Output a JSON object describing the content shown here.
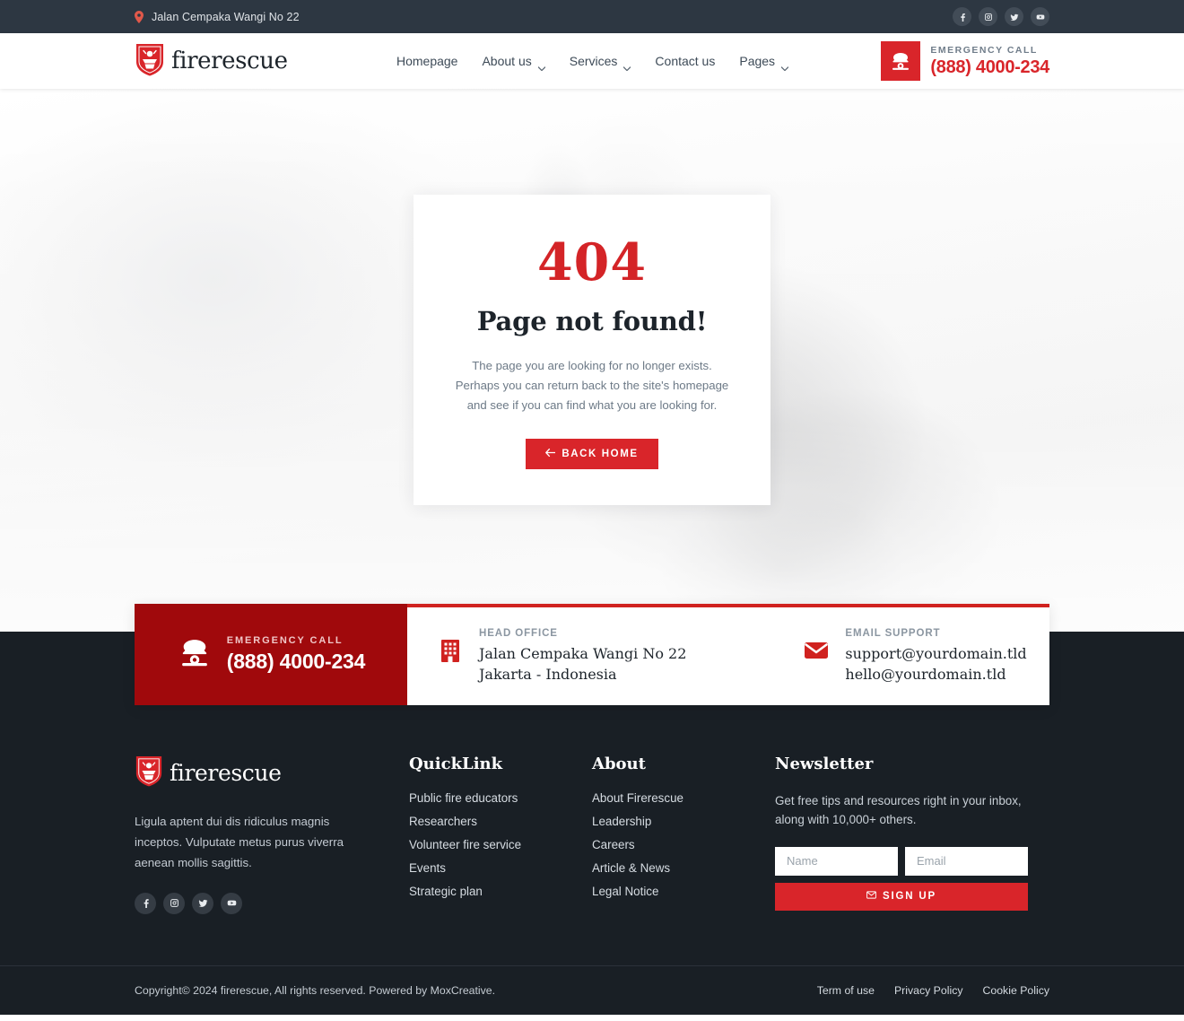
{
  "topbar": {
    "address": "Jalan Cempaka Wangi No 22",
    "pin_icon": "location-pin-icon",
    "social": [
      {
        "name": "facebook",
        "icon": "facebook-icon"
      },
      {
        "name": "instagram",
        "icon": "instagram-icon"
      },
      {
        "name": "twitter",
        "icon": "twitter-icon"
      },
      {
        "name": "youtube",
        "icon": "youtube-icon"
      }
    ]
  },
  "header": {
    "brand": "firerescue",
    "nav": [
      {
        "label": "Homepage",
        "dropdown": false
      },
      {
        "label": "About us",
        "dropdown": true
      },
      {
        "label": "Services",
        "dropdown": true
      },
      {
        "label": "Contact us",
        "dropdown": false
      },
      {
        "label": "Pages",
        "dropdown": true
      }
    ],
    "emergency_label": "EMERGENCY CALL",
    "emergency_number": "(888) 4000-234",
    "phone_icon": "telephone-icon"
  },
  "hero": {
    "code": "404",
    "title": "Page not found!",
    "description": "The page you are looking for no longer exists. Perhaps you can return back to the site's homepage and see if you can find what you are looking for.",
    "button_label": "BACK HOME",
    "button_icon": "arrow-left-icon"
  },
  "contact_bar": {
    "emergency": {
      "label": "EMERGENCY CALL",
      "number": "(888) 4000-234",
      "icon": "telephone-icon"
    },
    "head_office": {
      "label": "HEAD OFFICE",
      "line1": "Jalan Cempaka Wangi No 22",
      "line2": "Jakarta - Indonesia",
      "icon": "building-icon"
    },
    "email_support": {
      "label": "EMAIL SUPPORT",
      "line1": "support@yourdomain.tld",
      "line2": "hello@yourdomain.tld",
      "icon": "envelope-icon"
    }
  },
  "footer": {
    "brand": "firerescue",
    "description": "Ligula aptent dui dis ridiculus magnis inceptos. Vulputate metus purus viverra aenean mollis sagittis.",
    "social": [
      {
        "name": "facebook",
        "icon": "facebook-icon"
      },
      {
        "name": "instagram",
        "icon": "instagram-icon"
      },
      {
        "name": "twitter",
        "icon": "twitter-icon"
      },
      {
        "name": "youtube",
        "icon": "youtube-icon"
      }
    ],
    "quicklink": {
      "heading": "QuickLink",
      "items": [
        "Public fire educators",
        "Researchers",
        "Volunteer fire service",
        "Events",
        "Strategic plan"
      ]
    },
    "about": {
      "heading": "About",
      "items": [
        "About Firerescue",
        "Leadership",
        "Careers",
        "Article & News",
        "Legal Notice"
      ]
    },
    "newsletter": {
      "heading": "Newsletter",
      "description": "Get free tips and resources right in your inbox, along with 10,000+ others.",
      "name_placeholder": "Name",
      "email_placeholder": "Email",
      "name_value": "",
      "email_value": "",
      "signup_label": "SIGN UP",
      "signup_icon": "envelope-icon"
    },
    "copyright": "Copyright© 2024 firerescue, All rights reserved. Powered by MoxCreative.",
    "legal_links": [
      "Term of use",
      "Privacy Policy",
      "Cookie Policy"
    ]
  },
  "colors": {
    "brand_red": "#d9252a",
    "dark_red": "#a0090c",
    "topbar_dark": "#2d3742",
    "footer_dark": "#191f25"
  }
}
